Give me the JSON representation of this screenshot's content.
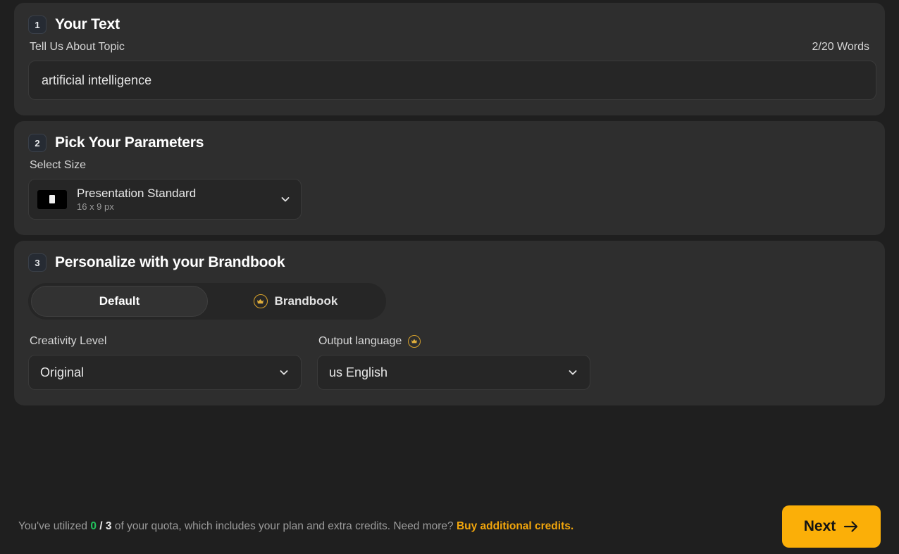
{
  "colors": {
    "page_bg": "#1f1f1f",
    "card_bg": "#2e2e2e",
    "field_bg": "#262626",
    "accent_amber": "#fbaf08",
    "link_amber": "#f2a60c",
    "quota_green": "#22c55e",
    "crown_gold": "#d8a22b"
  },
  "sections": [
    {
      "number": "1",
      "title": "Your Text",
      "field_label": "Tell Us About Topic",
      "word_count": "2/20 Words",
      "topic_value": "artificial intelligence",
      "topic_placeholder": "Tell Us About Topic"
    },
    {
      "number": "2",
      "title": "Pick Your Parameters",
      "field_label": "Select Size",
      "size": {
        "name": "Presentation Standard",
        "dimensions": "16 x 9 px",
        "thumb_icon": "slide-thumbnail-icon",
        "chevron_icon": "chevron-down-icon"
      }
    },
    {
      "number": "3",
      "title": "Personalize with your Brandbook",
      "toggle": {
        "options": [
          {
            "label": "Default",
            "active": true,
            "premium": false
          },
          {
            "label": "Brandbook",
            "active": false,
            "premium": true,
            "icon": "crown-icon"
          }
        ]
      },
      "creativity": {
        "label": "Creativity Level",
        "value": "Original",
        "chevron_icon": "chevron-down-icon"
      },
      "language": {
        "label": "Output language",
        "premium_icon": "crown-icon",
        "value": "us English",
        "chevron_icon": "chevron-down-icon"
      }
    }
  ],
  "footer": {
    "quota_prefix": "You've utilized",
    "quota_used": "0",
    "quota_separator": "/",
    "quota_total": "3",
    "quota_suffix": "of your quota, which includes your plan and extra credits. Need more?",
    "buy_link": "Buy additional credits.",
    "next_label": "Next",
    "next_icon": "arrow-right-icon"
  }
}
